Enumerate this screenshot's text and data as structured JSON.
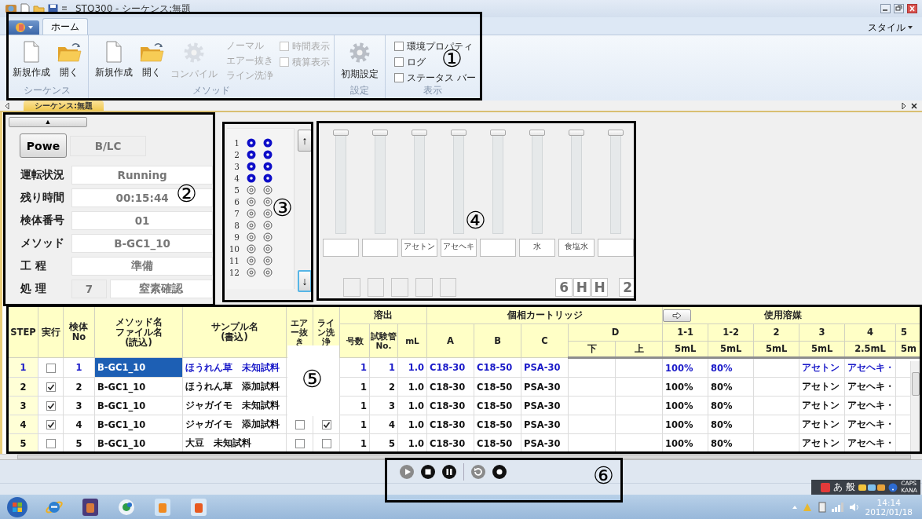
{
  "window": {
    "title": "STQ300 - シーケンス:無題"
  },
  "ribbon": {
    "tabs": [
      {
        "label": "ホーム",
        "selected": true
      }
    ],
    "style_menu": "スタイル",
    "groups": [
      {
        "title": "シーケンス",
        "buttons": [
          {
            "label": "新規作成",
            "kind": "new",
            "disabled": false
          },
          {
            "label": "開く",
            "kind": "open",
            "disabled": false
          }
        ]
      },
      {
        "title": "メソッド",
        "buttons": [
          {
            "label": "新規作成",
            "kind": "new",
            "disabled": false
          },
          {
            "label": "開く",
            "kind": "open",
            "disabled": false
          },
          {
            "label": "コンパイル",
            "kind": "gear",
            "disabled": true
          }
        ],
        "options": [
          {
            "label": "ノーマル",
            "disabled": true
          },
          {
            "label": "エアー抜き",
            "disabled": true
          },
          {
            "label": "ライン洗浄",
            "disabled": true
          }
        ],
        "checks": [
          {
            "label": "時間表示",
            "checked": false,
            "disabled": true
          },
          {
            "label": "積算表示",
            "checked": false,
            "disabled": true
          }
        ]
      },
      {
        "title": "設定",
        "buttons": [
          {
            "label": "初期設定",
            "kind": "gear",
            "disabled": false
          }
        ]
      },
      {
        "title": "表示",
        "checks": [
          {
            "label": "環境プロパティ",
            "checked": false,
            "disabled": false
          },
          {
            "label": "ログ",
            "checked": false,
            "disabled": false
          },
          {
            "label": "ステータス バー",
            "checked": false,
            "disabled": false
          }
        ]
      }
    ]
  },
  "document_tab": {
    "label": "シーケンス:無題"
  },
  "status_panel": {
    "collapse_button": "▲",
    "power_button": "Powe",
    "mode": "B/LC",
    "fields": [
      {
        "label": "運転状況",
        "value": "Running"
      },
      {
        "label": "残り時間",
        "value": "00:15:44"
      },
      {
        "label": "検体番号",
        "value": "01"
      },
      {
        "label": "メソッド",
        "value": "B-GC1_10"
      },
      {
        "label": "工 程",
        "value": "準備"
      },
      {
        "label": "処 理",
        "step": "7",
        "value": "窒素確認"
      }
    ]
  },
  "column_panel": {
    "up_button": "↑",
    "down_button": "↓",
    "rows": [
      {
        "number": "1",
        "left": true,
        "right": true
      },
      {
        "number": "2",
        "left": true,
        "right": true
      },
      {
        "number": "3",
        "left": true,
        "right": true
      },
      {
        "number": "4",
        "left": true,
        "right": true
      },
      {
        "number": "5",
        "left": false,
        "right": false
      },
      {
        "number": "6",
        "left": false,
        "right": false
      },
      {
        "number": "7",
        "left": false,
        "right": false
      },
      {
        "number": "8",
        "left": false,
        "right": false
      },
      {
        "number": "9",
        "left": false,
        "right": false
      },
      {
        "number": "10",
        "left": false,
        "right": false
      },
      {
        "number": "11",
        "left": false,
        "right": false
      },
      {
        "number": "12",
        "left": false,
        "right": false
      }
    ]
  },
  "slider_panel": {
    "sliders": [
      {
        "level": 1
      },
      {
        "level": 1
      },
      {
        "level": 1,
        "label": "アセトン"
      },
      {
        "level": 1,
        "label": "アセヘキ"
      },
      {
        "level": 1
      },
      {
        "level": 1,
        "label": "水"
      },
      {
        "level": 1,
        "label": "食塩水"
      },
      {
        "level": 1
      }
    ],
    "indicators": [
      {
        "kind": "blank"
      },
      {
        "kind": "blank"
      },
      {
        "kind": "blank"
      },
      {
        "kind": "blank"
      },
      {
        "kind": "blank"
      },
      {
        "kind": "gap"
      },
      {
        "kind": "text",
        "text": "6"
      },
      {
        "kind": "text",
        "text": "H"
      },
      {
        "kind": "text",
        "text": "H"
      },
      {
        "kind": "gap"
      },
      {
        "kind": "text",
        "text": "2"
      }
    ]
  },
  "table": {
    "headers": {
      "step": "STEP",
      "run": "実行",
      "specimen_no": "検体No",
      "method": "メソッド名ファイル名(読込)",
      "sample": "サンプル名(書込)",
      "air_purge": "エアー抜き",
      "line_wash": "ライン洗浄",
      "elution": "溶出",
      "elution_columns": [
        "号数",
        "試験管No.",
        "mL"
      ],
      "cartridge": "個相カートリッジ",
      "cartridge_columns": [
        "A",
        "B",
        "C"
      ],
      "cartridge_d": "D",
      "cartridge_d_columns": [
        "下",
        "上"
      ],
      "solvent": "使用溶媒",
      "solvent_columns": [
        {
          "name": "1-1",
          "volume": "5mL"
        },
        {
          "name": "1-2",
          "volume": "5mL"
        },
        {
          "name": "2",
          "volume": "5mL"
        },
        {
          "name": "3",
          "volume": "5mL"
        },
        {
          "name": "4",
          "volume": "2.5mL"
        },
        {
          "name": "5",
          "volume": "5m"
        }
      ]
    },
    "rows": [
      {
        "step": "1",
        "selected": true,
        "run": false,
        "no": "1",
        "method": "B-GC1_10",
        "sample": "ほうれん草　未知試料",
        "number": "1",
        "tube": "1",
        "ml": "1.0",
        "a": "C18-30",
        "b": "C18-50",
        "c": "PSA-30",
        "solvent_1_1": "100%",
        "solvent_1_2": "80%",
        "solvent_3": "アセトン",
        "solvent_4": "アセヘキ・"
      },
      {
        "step": "2",
        "selected": false,
        "run": true,
        "no": "2",
        "method": "B-GC1_10",
        "sample": "ほうれん草　添加試料",
        "number": "1",
        "tube": "2",
        "ml": "1.0",
        "a": "C18-30",
        "b": "C18-50",
        "c": "PSA-30",
        "solvent_1_1": "100%",
        "solvent_1_2": "80%",
        "solvent_3": "アセトン",
        "solvent_4": "アセヘキ・"
      },
      {
        "step": "3",
        "selected": false,
        "run": true,
        "no": "3",
        "method": "B-GC1_10",
        "sample": "ジャガイモ　未知試料",
        "number": "1",
        "tube": "3",
        "ml": "1.0",
        "a": "C18-30",
        "b": "C18-50",
        "c": "PSA-30",
        "solvent_1_1": "100%",
        "solvent_1_2": "80%",
        "solvent_3": "アセトン",
        "solvent_4": "アセヘキ・"
      },
      {
        "step": "4",
        "selected": false,
        "run": true,
        "no": "4",
        "method": "B-GC1_10",
        "sample": "ジャガイモ　添加試料",
        "air_purge": false,
        "line_wash": true,
        "number": "1",
        "tube": "4",
        "ml": "1.0",
        "a": "C18-30",
        "b": "C18-50",
        "c": "PSA-30",
        "solvent_1_1": "100%",
        "solvent_1_2": "80%",
        "solvent_3": "アセトン",
        "solvent_4": "アセヘキ・"
      },
      {
        "step": "5",
        "selected": false,
        "run": false,
        "no": "5",
        "method": "B-GC1_10",
        "sample": "大豆　未知試料",
        "air_purge": false,
        "line_wash": false,
        "number": "1",
        "tube": "5",
        "ml": "1.0",
        "a": "C18-30",
        "b": "C18-50",
        "c": "PSA-30",
        "solvent_1_1": "100%",
        "solvent_1_2": "80%",
        "solvent_3": "アセトン",
        "solvent_4": "アセヘキ・"
      }
    ]
  },
  "run_toolbar": {
    "buttons": [
      {
        "kind": "play",
        "disabled": true
      },
      {
        "kind": "stop",
        "disabled": false
      },
      {
        "kind": "pause",
        "disabled": false
      },
      {
        "kind": "rewind",
        "disabled": true
      },
      {
        "kind": "record",
        "disabled": false
      }
    ]
  },
  "taskbar": {
    "ime": [
      "あ",
      "般"
    ],
    "caps": "CAPS",
    "kana": "KANA",
    "time": "14:14",
    "date": "2012/01/18"
  },
  "annotations": [
    {
      "label": "①"
    },
    {
      "label": "②"
    },
    {
      "label": "③"
    },
    {
      "label": "④"
    },
    {
      "label": "⑤",
      "mask": true
    },
    {
      "label": "⑥"
    }
  ]
}
